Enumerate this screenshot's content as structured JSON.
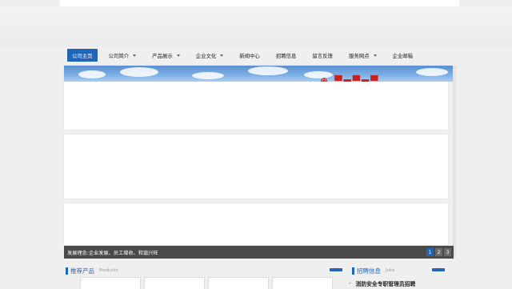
{
  "nav": {
    "items": [
      {
        "label": "公司主页",
        "active": true,
        "dropdown": false
      },
      {
        "label": "公司简介",
        "active": false,
        "dropdown": true
      },
      {
        "label": "产品展示",
        "active": false,
        "dropdown": true
      },
      {
        "label": "企业文化",
        "active": false,
        "dropdown": true
      },
      {
        "label": "新闻中心",
        "active": false,
        "dropdown": false
      },
      {
        "label": "招聘信息",
        "active": false,
        "dropdown": false
      },
      {
        "label": "留言反馈",
        "active": false,
        "dropdown": false
      },
      {
        "label": "服务网点",
        "active": false,
        "dropdown": true
      },
      {
        "label": "企业邮箱",
        "active": false,
        "dropdown": false
      }
    ]
  },
  "banner": {
    "caption": "发展理念:企业发展、员工增收、和谐兴旺",
    "pager": [
      "1",
      "2",
      "3"
    ],
    "current_page": "1"
  },
  "products": {
    "title": "推荐产品",
    "subtitle": "Products"
  },
  "jobs": {
    "title": "招聘信息",
    "subtitle": "Jobs",
    "items": [
      {
        "dash": "-",
        "text": "消防安全专职管理员招聘"
      }
    ]
  },
  "colors": {
    "accent": "#1f66b8",
    "caption_bg": "#4a4a4a",
    "page_bg": "#efefef"
  }
}
